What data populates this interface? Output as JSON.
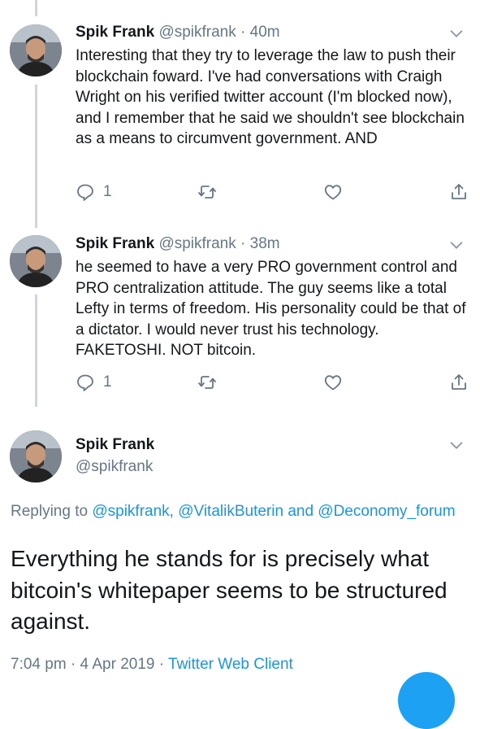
{
  "tweets": [
    {
      "name": "Spik Frank",
      "handle": "@spikfrank",
      "dot": "·",
      "time": "40m",
      "text": "Interesting that they try to leverage the law to push their blockchain foward. I've had conversations with Craigh Wright on his verified twitter account (I'm blocked now), and I remember that he said we shouldn't see blockchain as a means to circumvent government. AND",
      "reply_count": "1"
    },
    {
      "name": "Spik Frank",
      "handle": "@spikfrank",
      "dot": "·",
      "time": "38m",
      "text": "he seemed to have a very PRO government control and PRO centralization attitude. The guy seems like a total Lefty in terms of freedom. His personality could be that of a dictator. I would never trust his technology. FAKETOSHI. NOT bitcoin.",
      "reply_count": "1"
    }
  ],
  "main_tweet": {
    "name": "Spik Frank",
    "handle": "@spikfrank",
    "replying_prefix": "Replying to ",
    "replying_mentions": "@spikfrank, @VitalikButerin and @Deconomy_forum",
    "text": "Everything he stands for is precisely what bitcoin's whitepaper seems to be structured against.",
    "time": "7:04 pm",
    "date": "4 Apr 2019",
    "separator": "·",
    "client": "Twitter Web Client"
  },
  "colors": {
    "text": "#14171a",
    "secondary": "#657786",
    "link": "#1b95e0",
    "accent": "#1da1f2",
    "thread_line": "#ccd6dd"
  },
  "icons": [
    "reply-icon",
    "retweet-icon",
    "like-icon",
    "share-icon",
    "chevron-down-icon"
  ]
}
